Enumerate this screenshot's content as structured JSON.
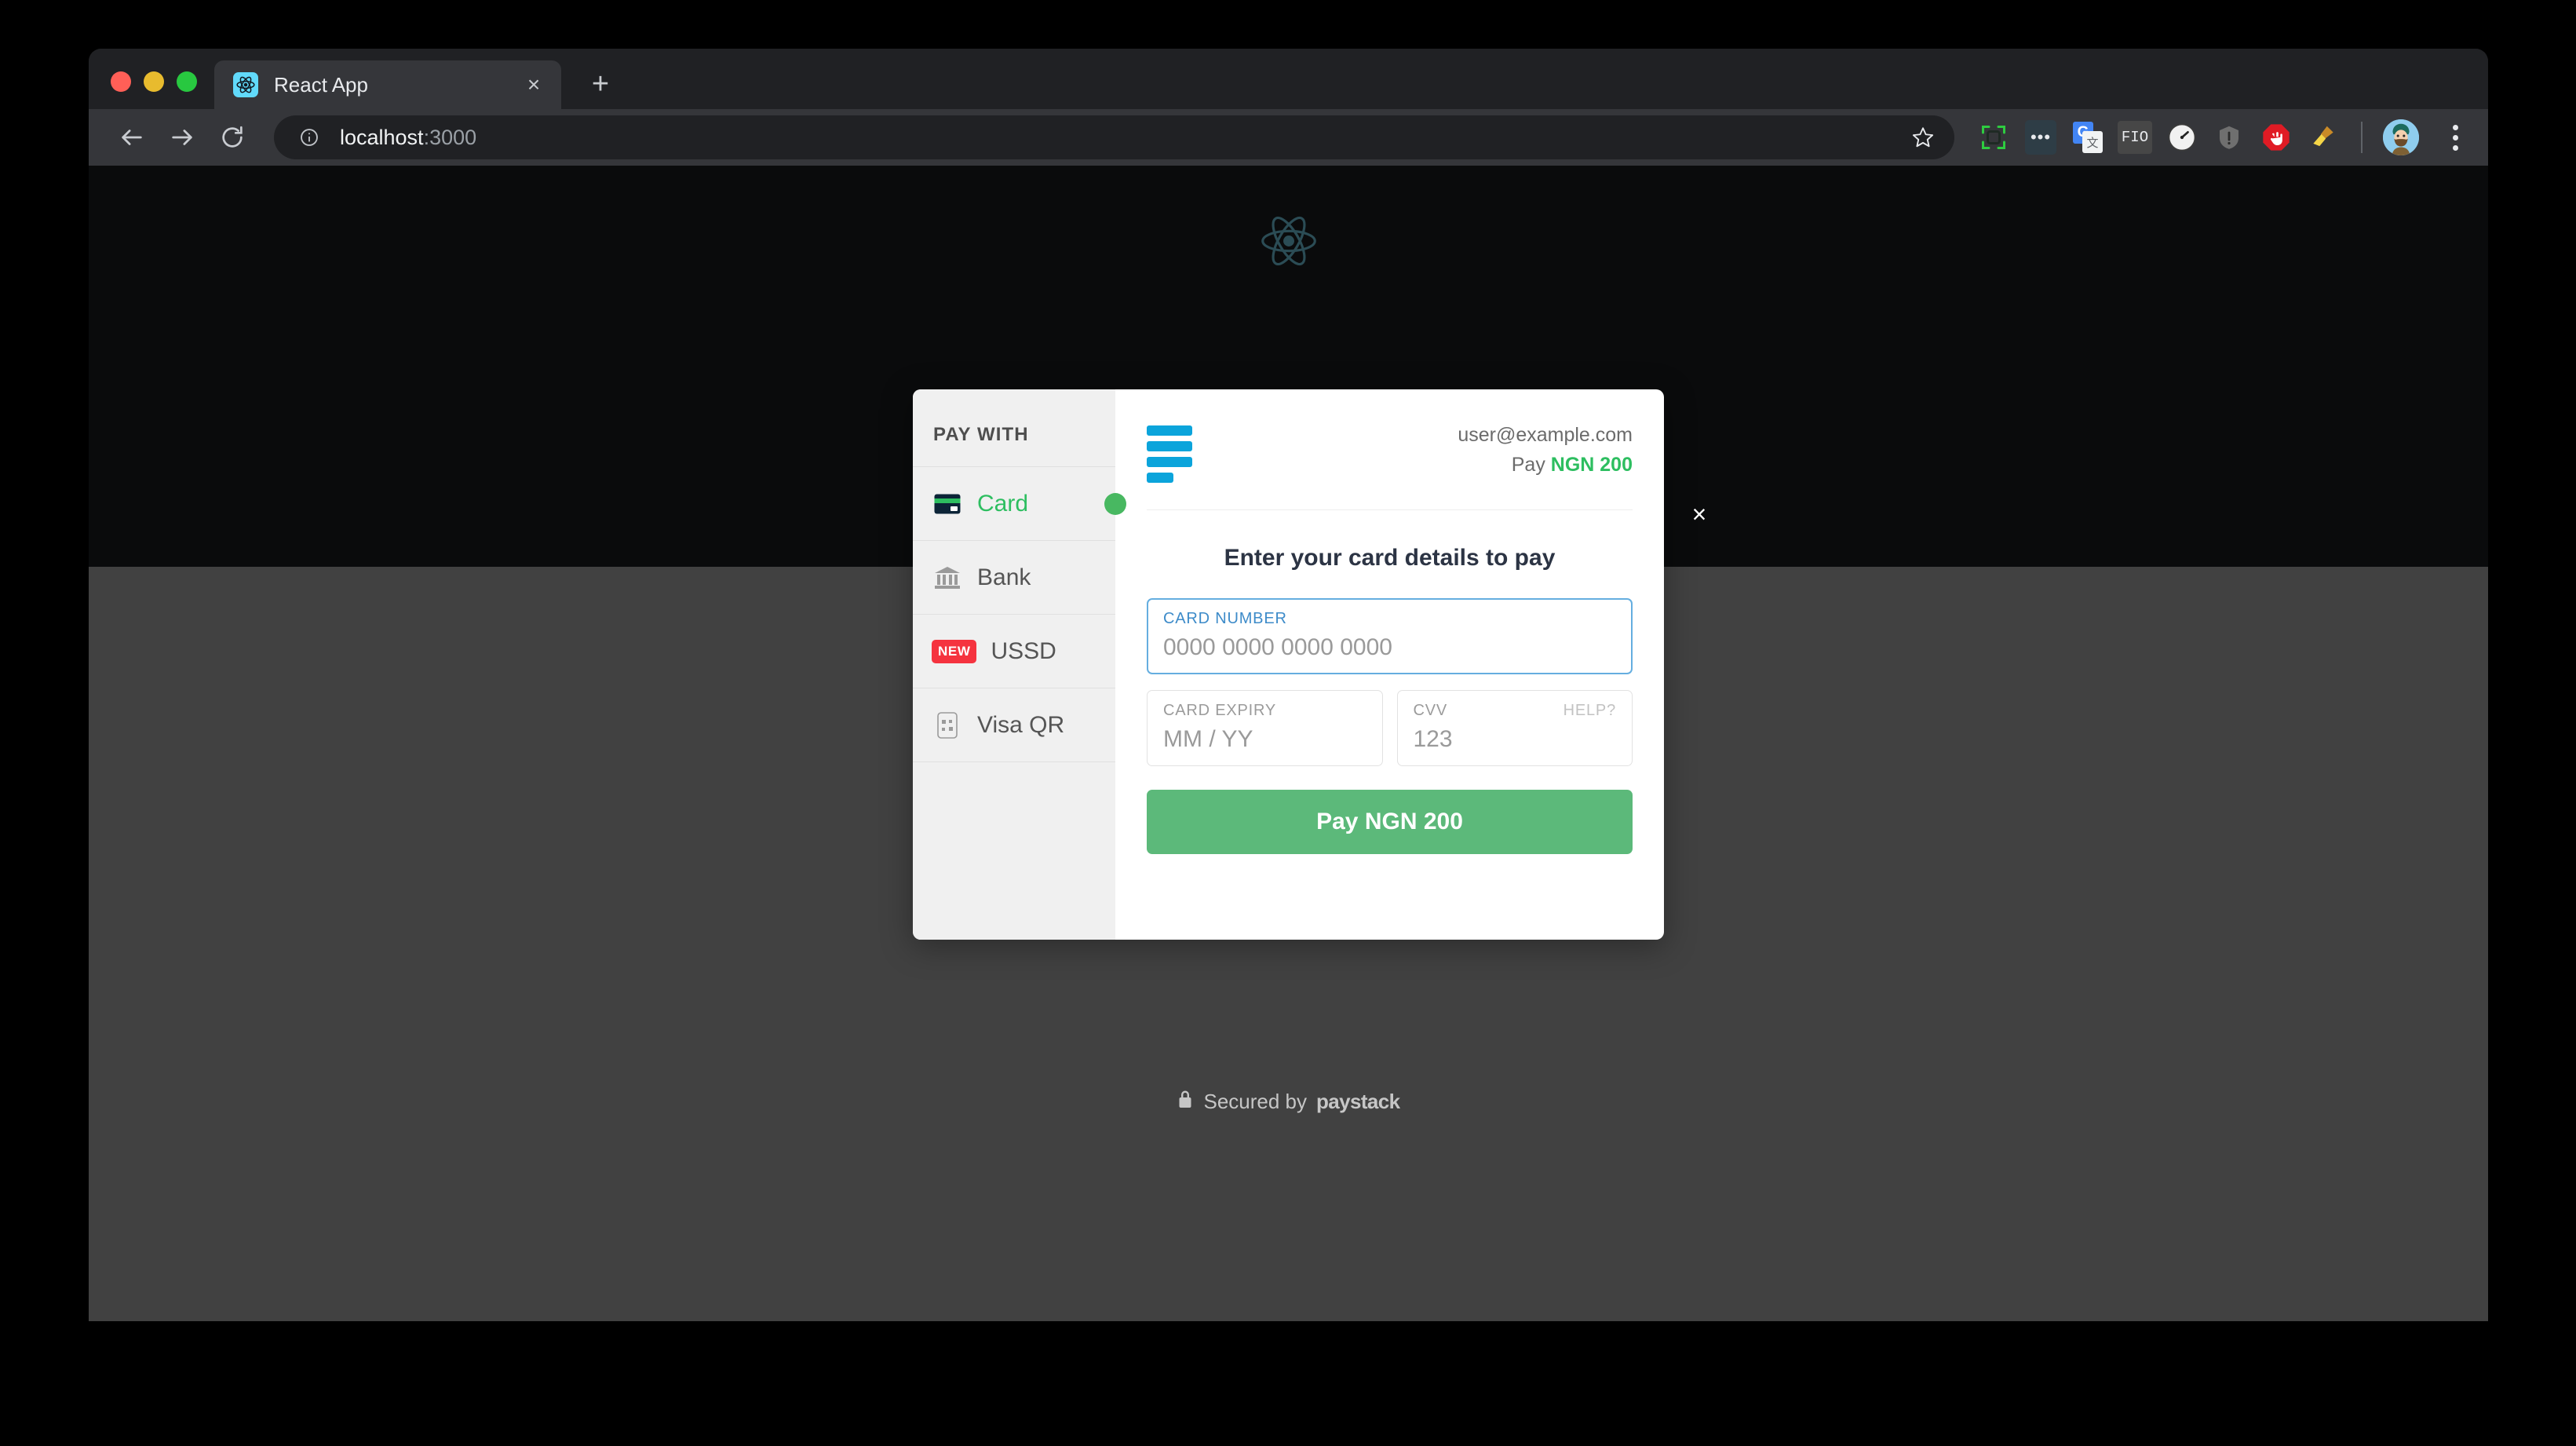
{
  "browser": {
    "tab": {
      "title": "React App",
      "favicon": "react-logo-icon",
      "close_label": "×"
    },
    "new_tab_label": "+",
    "nav": {
      "back": "←",
      "forward": "→",
      "reload": "⟳"
    },
    "omnibox": {
      "url_host": "localhost",
      "url_port": ":3000",
      "site_info_icon": "info-circle-icon",
      "star_icon": "bookmark-star-icon"
    },
    "extensions": [
      {
        "name": "scan-extension-icon",
        "label": ""
      },
      {
        "name": "dots-extension-icon",
        "label": "•••"
      },
      {
        "name": "google-translate-icon",
        "label": "G"
      },
      {
        "name": "fio-extension-icon",
        "label": "FIO"
      },
      {
        "name": "speedometer-extension-icon",
        "label": ""
      },
      {
        "name": "shield-warning-extension-icon",
        "label": "!"
      },
      {
        "name": "adblock-stop-extension-icon",
        "label": ""
      },
      {
        "name": "broom-extension-icon",
        "label": ""
      }
    ],
    "profile_avatar": "user-avatar",
    "menu_icon": "three-dot-menu-icon"
  },
  "page": {
    "logo_icon": "react-atom-logo"
  },
  "checkout": {
    "sidebar": {
      "heading": "PAY WITH",
      "methods": [
        {
          "label": "Card",
          "icon": "credit-card-icon",
          "active": true,
          "badge": null
        },
        {
          "label": "Bank",
          "icon": "bank-building-icon",
          "active": false,
          "badge": null
        },
        {
          "label": "USSD",
          "icon": null,
          "active": false,
          "badge": "NEW"
        },
        {
          "label": "Visa QR",
          "icon": "phone-qr-icon",
          "active": false,
          "badge": null
        }
      ]
    },
    "header": {
      "logo_icon": "paystack-bars-logo",
      "email": "user@example.com",
      "pay_prefix": "Pay",
      "amount": "NGN 200"
    },
    "title": "Enter your card details to pay",
    "fields": {
      "card_number": {
        "label": "CARD NUMBER",
        "placeholder": "0000 0000 0000 0000",
        "value": "",
        "focused": true
      },
      "card_expiry": {
        "label": "CARD EXPIRY",
        "placeholder": "MM / YY",
        "value": "",
        "focused": false
      },
      "cvv": {
        "label": "CVV",
        "help_label": "HELP?",
        "placeholder": "123",
        "value": "",
        "focused": false
      }
    },
    "submit_label": "Pay NGN 200",
    "close_label": "×",
    "footer": {
      "lock_icon": "lock-icon",
      "secured_text": "Secured by",
      "brand": "paystack"
    },
    "colors": {
      "accent_green": "#2dbe60",
      "button_green": "#5cb97a",
      "focus_blue": "#65aee0",
      "logo_blue": "#0ba4db",
      "badge_red": "#f5333f"
    }
  }
}
